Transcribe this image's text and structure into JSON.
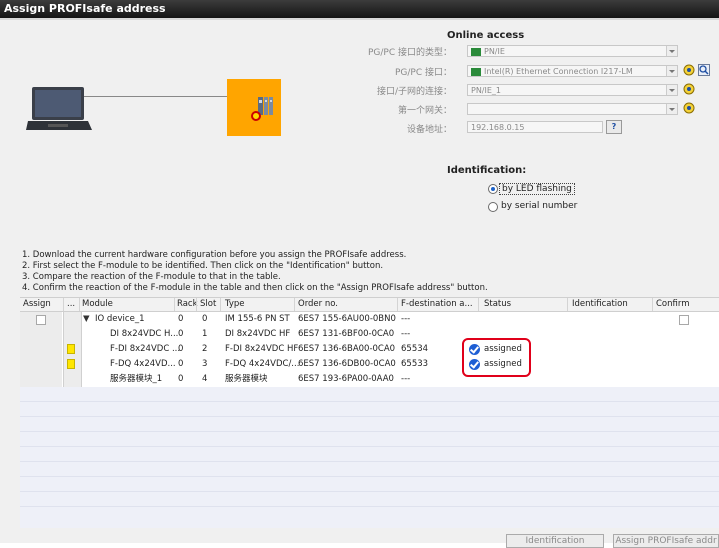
{
  "window": {
    "title": "Assign PROFIsafe address"
  },
  "online_access": {
    "title": "Online access",
    "rows": [
      {
        "label": "PG/PC 接口的类型：",
        "value": "PN/IE"
      },
      {
        "label": "PG/PC 接口：",
        "value": "Intel(R) Ethernet Connection I217-LM"
      },
      {
        "label": "接口/子网的连接：",
        "value": "PN/IE_1"
      },
      {
        "label": "第一个网关：",
        "value": ""
      },
      {
        "label": "设备地址：",
        "value": "192.168.0.15"
      }
    ]
  },
  "identification": {
    "title": "Identification:",
    "option_led": "by LED flashing",
    "option_serial": "by serial number"
  },
  "instructions": [
    "1. Download the current hardware configuration before you assign the PROFIsafe address.",
    "2. First select the F-module to be identified. Then click on the \"Identification\" button.",
    "3. Compare the reaction of the F-module to that in the table.",
    "4. Confirm the reaction of the F-module in the table and then click on the \"Assign PROFIsafe address\" button."
  ],
  "table": {
    "headers": {
      "assign": "Assign",
      "dots": "...",
      "module": "Module",
      "rack": "Rack",
      "slot": "Slot",
      "type": "Type",
      "order": "Order no.",
      "fdest": "F-destination a...",
      "status": "Status",
      "ident": "Identification",
      "confirm": "Confirm"
    },
    "rows": [
      {
        "module": "IO device_1",
        "rack": "0",
        "slot": "0",
        "type": "IM 155-6 PN ST",
        "order": "6ES7 155-6AU00-0BN0",
        "fdest": "---",
        "status": ""
      },
      {
        "module": "DI 8x24VDC H...",
        "rack": "0",
        "slot": "1",
        "type": "DI 8x24VDC HF",
        "order": "6ES7 131-6BF00-0CA0",
        "fdest": "---",
        "status": ""
      },
      {
        "module": "F-DI 8x24VDC ...",
        "rack": "0",
        "slot": "2",
        "type": "F-DI 8x24VDC HF",
        "order": "6ES7 136-6BA00-0CA0",
        "fdest": "65534",
        "status": "assigned"
      },
      {
        "module": "F-DQ 4x24VD...",
        "rack": "0",
        "slot": "3",
        "type": "F-DQ 4x24VDC/...",
        "order": "6ES7 136-6DB00-0CA0",
        "fdest": "65533",
        "status": "assigned"
      },
      {
        "module": "服务器模块_1",
        "rack": "0",
        "slot": "4",
        "type": "服务器模块",
        "order": "6ES7 193-6PA00-0AA0",
        "fdest": "---",
        "status": ""
      }
    ]
  },
  "buttons": {
    "identification": "Identification",
    "assign": "Assign PROFIsafe addr"
  },
  "colors": {
    "accent": "#1e5fd4",
    "device_box": "#ffa500",
    "highlight": "#e0001a"
  }
}
